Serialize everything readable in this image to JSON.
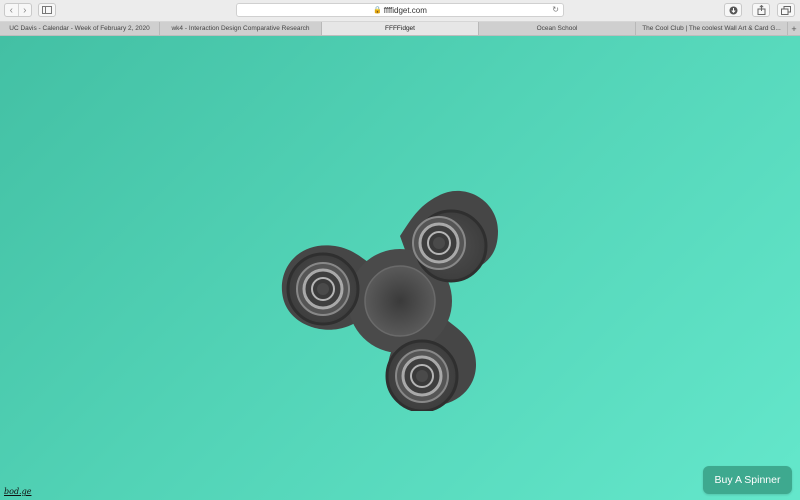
{
  "browser": {
    "url": "ffffidget.com",
    "tabs": [
      {
        "label": "UC Davis - Calendar - Week of February 2, 2020",
        "active": false
      },
      {
        "label": "wk4 - Interaction Design Comparative Research",
        "active": false
      },
      {
        "label": "FFFFidget",
        "active": true
      },
      {
        "label": "Ocean School",
        "active": false
      },
      {
        "label": "The Cool Club | The coolest Wall Art & Card G...",
        "active": false
      }
    ],
    "icons": {
      "back": "chevron-left-icon",
      "forward": "chevron-right-icon",
      "sidebar": "sidebar-icon",
      "lock": "lock-icon",
      "reload": "reload-icon",
      "download": "download-icon",
      "share": "share-icon",
      "tabs": "tabs-overview-icon",
      "new_tab": "plus-icon"
    }
  },
  "page": {
    "buy_button": "Buy A Spinner",
    "credit": "bod.ge",
    "colors": {
      "background_start": "#43c0a4",
      "background_end": "#64e7cb",
      "button": "#3ea98f",
      "spinner": "#4a4a4a"
    }
  }
}
